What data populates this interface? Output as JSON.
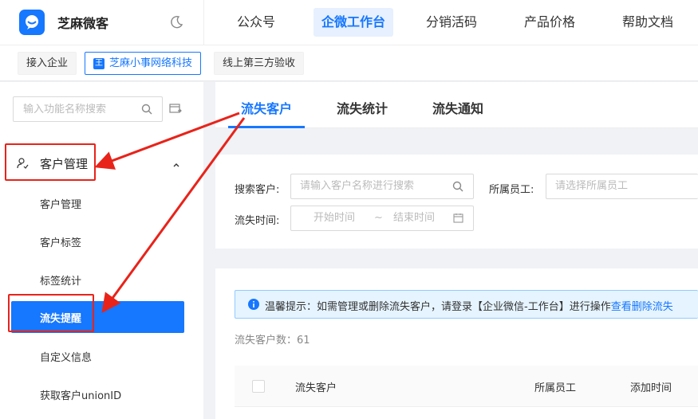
{
  "brand": {
    "name": "芝麻微客",
    "logo_icon": "chat-bubble-icon",
    "theme_icon": "moon-icon"
  },
  "topnav": {
    "items": [
      {
        "label": "公众号"
      },
      {
        "label": "企微工作台",
        "active": true
      },
      {
        "label": "分销活码"
      },
      {
        "label": "产品价格"
      },
      {
        "label": "帮助文档"
      }
    ]
  },
  "subbar": {
    "chips": [
      {
        "label": "接入企业"
      },
      {
        "label": "芝麻小事网络科技",
        "active": true,
        "icon_text": "王"
      },
      {
        "label": "线上第三方验收"
      }
    ]
  },
  "sidebar": {
    "search_placeholder": "输入功能名称搜索",
    "group_label": "客户管理",
    "items": [
      {
        "label": "客户管理"
      },
      {
        "label": "客户标签"
      },
      {
        "label": "标签统计"
      },
      {
        "label": "流失提醒",
        "active": true
      },
      {
        "label": "自定义信息"
      },
      {
        "label": "获取客户unionID"
      }
    ]
  },
  "tabs": [
    {
      "label": "流失客户",
      "active": true
    },
    {
      "label": "流失统计"
    },
    {
      "label": "流失通知"
    }
  ],
  "filters": {
    "search_label": "搜索客户:",
    "search_placeholder": "请输入客户名称进行搜索",
    "staff_label": "所属员工:",
    "staff_placeholder": "请选择所属员工",
    "time_label": "流失时间:",
    "start_placeholder": "开始时间",
    "range_sep": "~",
    "end_placeholder": "结束时间"
  },
  "notice": {
    "text": "温馨提示：如需管理或删除流失客户，请登录【企业微信-工作台】进行操作",
    "link": "查看删除流失"
  },
  "count_text": "流失客户数：61",
  "table": {
    "headers": [
      "流失客户",
      "所属员工",
      "添加时间"
    ]
  },
  "colors": {
    "accent": "#1677ff",
    "annotation": "#e8231a"
  }
}
